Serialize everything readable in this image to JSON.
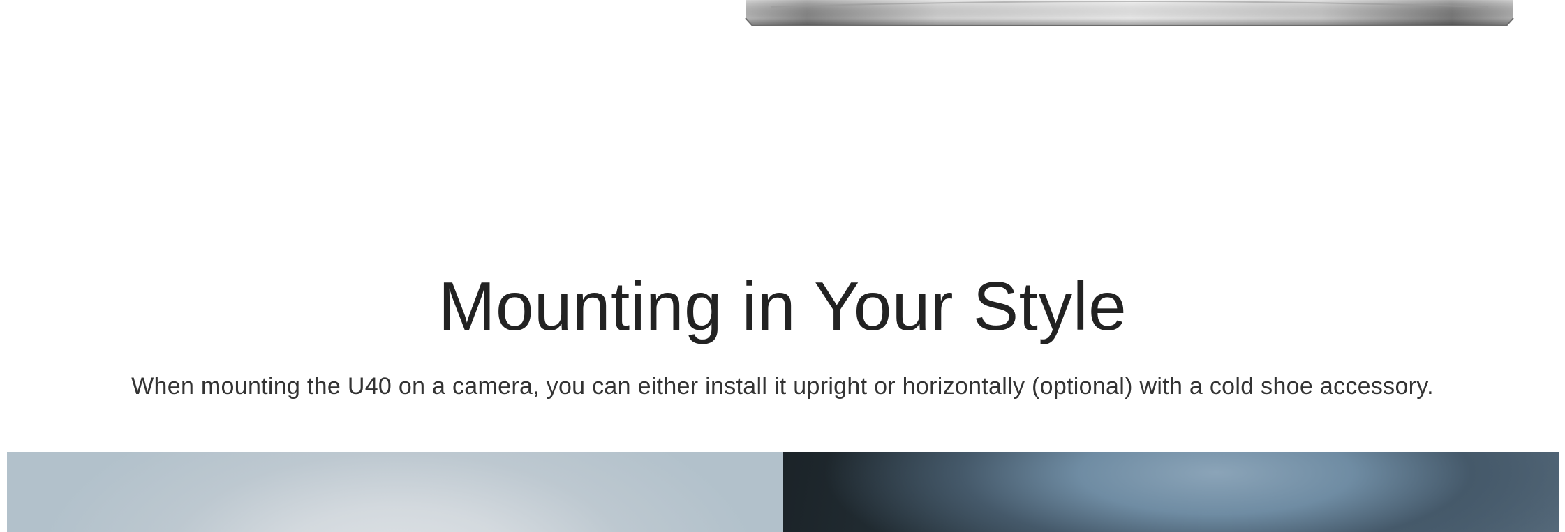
{
  "section": {
    "title": "Mounting in Your Style",
    "description": "When mounting the U40 on a camera, you can either install it upright or horizontally (optional) with a cold shoe accessory."
  },
  "gallery": {
    "tiles": [
      {
        "id": "upright"
      },
      {
        "id": "horizontal"
      }
    ]
  }
}
